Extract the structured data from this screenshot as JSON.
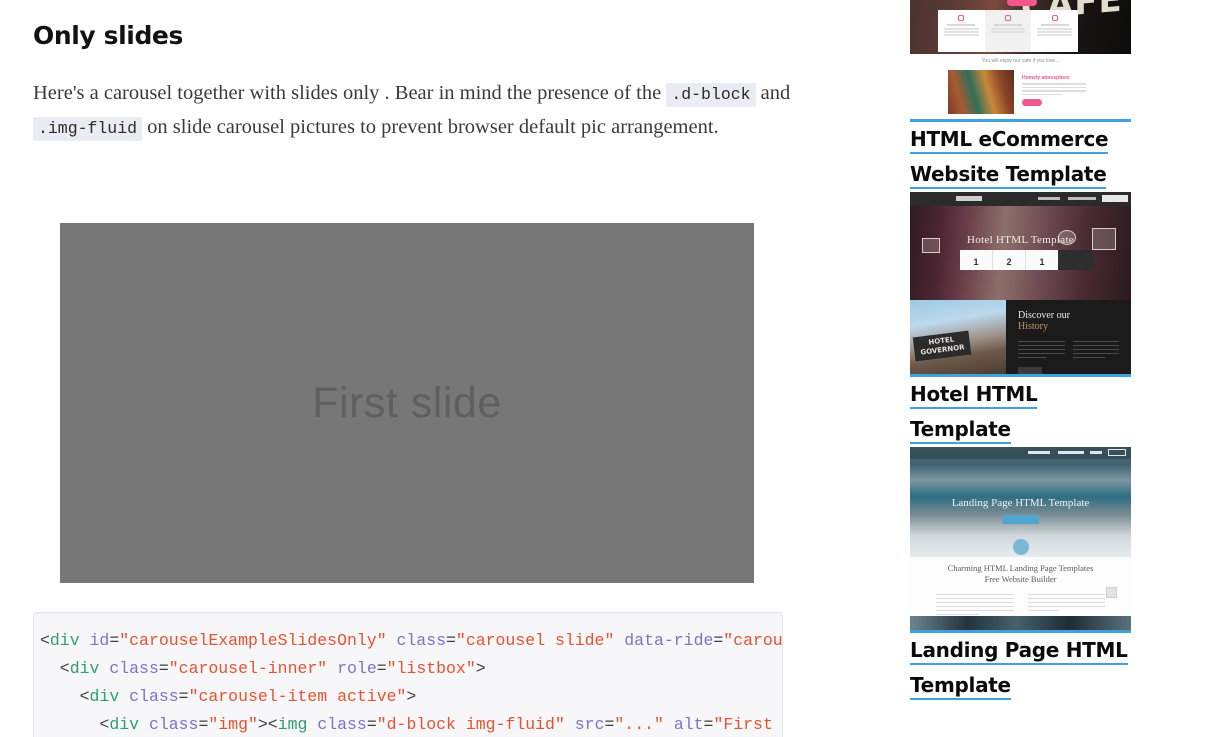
{
  "main": {
    "title": "Only slides",
    "paragraph": {
      "part1": "Here's a carousel together with slides only . Bear in mind the presence of the ",
      "code1": ".d-block",
      "part2": " and ",
      "code2": ".img-fluid",
      "part3": " on slide carousel pictures to prevent browser default pic arrangement."
    },
    "carousel": {
      "slide_label": "First slide"
    },
    "code_block": {
      "lines": [
        [
          {
            "t": "<",
            "c": "punc"
          },
          {
            "t": "div",
            "c": "tag"
          },
          {
            "t": " ",
            "c": "punc"
          },
          {
            "t": "id",
            "c": "attr"
          },
          {
            "t": "=",
            "c": "eq"
          },
          {
            "t": "\"carouselExampleSlidesOnly\"",
            "c": "str"
          },
          {
            "t": " ",
            "c": "punc"
          },
          {
            "t": "class",
            "c": "attr"
          },
          {
            "t": "=",
            "c": "eq"
          },
          {
            "t": "\"carousel slide\"",
            "c": "str"
          },
          {
            "t": " ",
            "c": "punc"
          },
          {
            "t": "data-ride",
            "c": "attr"
          },
          {
            "t": "=",
            "c": "eq"
          },
          {
            "t": "\"carousel\"",
            "c": "str"
          },
          {
            "t": ">",
            "c": "punc"
          }
        ],
        [
          {
            "t": "  <",
            "c": "punc"
          },
          {
            "t": "div",
            "c": "tag"
          },
          {
            "t": " ",
            "c": "punc"
          },
          {
            "t": "class",
            "c": "attr"
          },
          {
            "t": "=",
            "c": "eq"
          },
          {
            "t": "\"carousel-inner\"",
            "c": "str"
          },
          {
            "t": " ",
            "c": "punc"
          },
          {
            "t": "role",
            "c": "attr"
          },
          {
            "t": "=",
            "c": "eq"
          },
          {
            "t": "\"listbox\"",
            "c": "str"
          },
          {
            "t": ">",
            "c": "punc"
          }
        ],
        [
          {
            "t": "    <",
            "c": "punc"
          },
          {
            "t": "div",
            "c": "tag"
          },
          {
            "t": " ",
            "c": "punc"
          },
          {
            "t": "class",
            "c": "attr"
          },
          {
            "t": "=",
            "c": "eq"
          },
          {
            "t": "\"carousel-item active\"",
            "c": "str"
          },
          {
            "t": ">",
            "c": "punc"
          }
        ],
        [
          {
            "t": "      <",
            "c": "punc"
          },
          {
            "t": "div",
            "c": "tag"
          },
          {
            "t": " ",
            "c": "punc"
          },
          {
            "t": "class",
            "c": "attr"
          },
          {
            "t": "=",
            "c": "eq"
          },
          {
            "t": "\"img\"",
            "c": "str"
          },
          {
            "t": "><",
            "c": "punc"
          },
          {
            "t": "img",
            "c": "tag"
          },
          {
            "t": " ",
            "c": "punc"
          },
          {
            "t": "class",
            "c": "attr"
          },
          {
            "t": "=",
            "c": "eq"
          },
          {
            "t": "\"d-block img-fluid\"",
            "c": "str"
          },
          {
            "t": " ",
            "c": "punc"
          },
          {
            "t": "src",
            "c": "attr"
          },
          {
            "t": "=",
            "c": "eq"
          },
          {
            "t": "\"...\"",
            "c": "str"
          },
          {
            "t": " ",
            "c": "punc"
          },
          {
            "t": "alt",
            "c": "attr"
          },
          {
            "t": "=",
            "c": "eq"
          },
          {
            "t": "\"First slide\"",
            "c": "str"
          },
          {
            "t": ">",
            "c": "punc"
          }
        ]
      ]
    }
  },
  "sidebar": {
    "promos": [
      {
        "id": "ecommerce",
        "link_line1": "HTML eCommerce",
        "link_line2": "Website Template",
        "thumb_texts": {
          "hero_word": "CAFE",
          "caption": "You will enjoy our cafe if you love...",
          "feature_heading": "Homely atmosphere"
        }
      },
      {
        "id": "hotel",
        "link_line1": "Hotel HTML Template",
        "link_line2": "",
        "thumb_texts": {
          "hero_title": "Hotel HTML Template",
          "booking_fields": [
            "1",
            "2",
            "1"
          ],
          "sign_text": "HOTEL GOVERNOR",
          "section_title1": "Discover our",
          "section_title2": "History"
        }
      },
      {
        "id": "landing",
        "link_line1": "Landing Page HTML",
        "link_line2": "Template",
        "thumb_texts": {
          "hero_title": "Landing Page HTML Template",
          "body_title1": "Charming HTML Landing Page Templates",
          "body_title2": "Free Website Builder"
        }
      }
    ]
  },
  "colors": {
    "accent_blue": "#3fa2e0",
    "slide_gray": "#777777",
    "code_bg": "#f7f7f9",
    "inline_code_bg": "#e7edf3",
    "string_orange": "#e8512f",
    "tag_green": "#2f9e6e",
    "attr_purple": "#7a73c9"
  }
}
